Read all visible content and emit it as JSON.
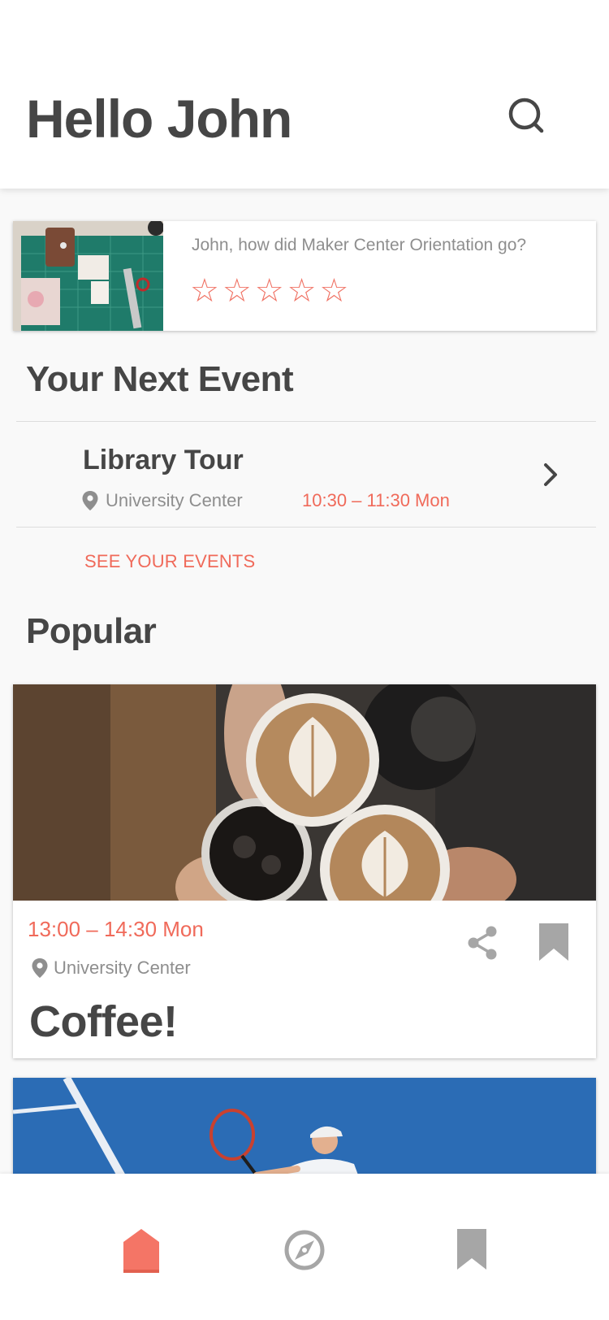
{
  "header": {
    "greeting": "Hello John",
    "search_icon": "search-icon"
  },
  "rating_prompt": {
    "question": "John, how did Maker Center Orientation go?",
    "star_glyph": "☆",
    "max_stars": 5,
    "current_rating": 0,
    "star_color": "#f07264"
  },
  "next_event": {
    "section_title": "Your Next Event",
    "title": "Library Tour",
    "location": "University Center",
    "time": "10:30 – 11:30  Mon",
    "see_all_label": "SEE YOUR EVENTS"
  },
  "popular": {
    "section_title": "Popular",
    "cards": [
      {
        "time": "13:00 – 14:30  Mon",
        "location": "University Center",
        "title": "Coffee!"
      }
    ]
  },
  "tabbar": {
    "items": [
      {
        "icon": "home-icon",
        "active": true
      },
      {
        "icon": "compass-icon",
        "active": false
      },
      {
        "icon": "bookmark-icon",
        "active": false
      }
    ]
  },
  "colors": {
    "accent": "#f06a5a",
    "text": "#464646",
    "muted": "#8e8e8e",
    "inactive_icon": "#a6a6a6"
  }
}
